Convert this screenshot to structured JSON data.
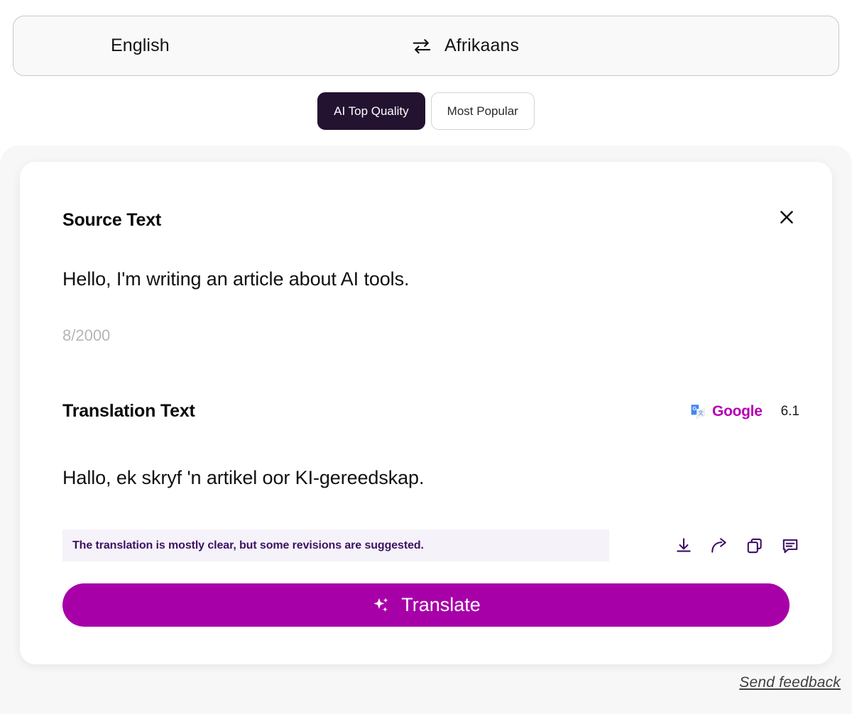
{
  "language_bar": {
    "source_language": "English",
    "target_language": "Afrikaans",
    "swap_icon": "swap-horizontal-arrows-icon"
  },
  "mode_toggle": {
    "options": [
      {
        "label": "AI Top Quality",
        "active": true
      },
      {
        "label": "Most Popular",
        "active": false
      }
    ]
  },
  "card": {
    "source": {
      "title": "Source Text",
      "text": "Hello, I'm writing an article about AI tools.",
      "char_count": "8/2000",
      "close_icon": "close-icon"
    },
    "translation": {
      "title": "Translation Text",
      "text": "Hallo, ek skryf 'n artikel oor KI-gereedskap.",
      "provider_name": "Google",
      "provider_icon": "google-translate-icon",
      "score": "6.1",
      "note": "The translation is mostly clear, but some revisions are suggested.",
      "actions": [
        {
          "name": "download-icon",
          "label": "Download"
        },
        {
          "name": "share-icon",
          "label": "Share"
        },
        {
          "name": "copy-icon",
          "label": "Copy"
        },
        {
          "name": "comment-icon",
          "label": "Comment"
        }
      ]
    },
    "translate_button": {
      "label": "Translate",
      "icon": "sparkles-icon"
    }
  },
  "footer": {
    "send_feedback": "Send feedback"
  },
  "colors": {
    "accent": "#a800a8",
    "provider_name": "#b400b4",
    "active_pill_bg": "#231330",
    "note_bg": "#f5f2f9",
    "note_text": "#3c1361",
    "panel_bg": "#f7f7f8"
  }
}
